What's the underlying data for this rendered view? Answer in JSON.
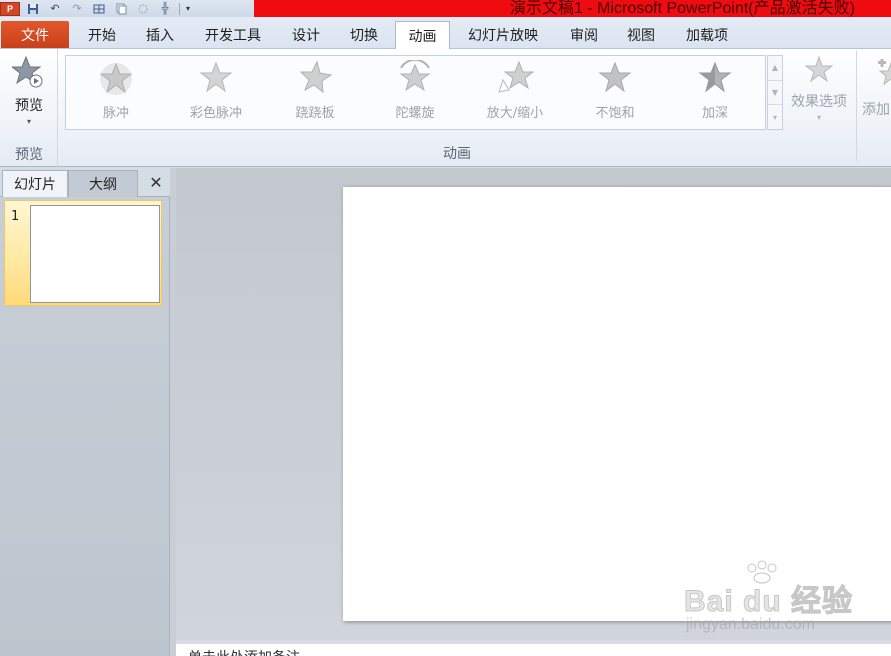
{
  "window": {
    "title": "演示文稿1 - Microsoft PowerPoint(产品激活失败)"
  },
  "quick_access": [
    {
      "icon": "save-icon"
    },
    {
      "icon": "undo-icon"
    },
    {
      "icon": "redo-icon"
    },
    {
      "icon": "table-icon"
    },
    {
      "icon": "copy-icon"
    },
    {
      "icon": "shape-icon"
    },
    {
      "icon": "format-painter-icon"
    },
    {
      "icon": "customize-dropdown-icon"
    }
  ],
  "tabs": {
    "file": "文件",
    "items": [
      "开始",
      "插入",
      "开发工具",
      "设计",
      "切换",
      "动画",
      "幻灯片放映",
      "审阅",
      "视图",
      "加载项"
    ],
    "active": "动画"
  },
  "ribbon": {
    "preview_group": {
      "button_label": "预览",
      "group_label": "预览"
    },
    "animation_group": {
      "effects": [
        "脉冲",
        "彩色脉冲",
        "跷跷板",
        "陀螺旋",
        "放大/缩小",
        "不饱和",
        "加深"
      ],
      "effect_options_label": "效果选项",
      "group_label": "动画"
    },
    "add_animation_label": "添加"
  },
  "left_panel": {
    "tab_slides": "幻灯片",
    "tab_outline": "大纲",
    "close_glyph": "✕",
    "slides": [
      {
        "number": "1"
      }
    ]
  },
  "notes": {
    "text": "单击此处添加备注"
  },
  "watermark": {
    "brand": "Bai du 经验",
    "url": "jingyan.baidu.com"
  },
  "colors": {
    "file_tab": "#d24726",
    "title_bar": "#ee0c10",
    "selection": "#ffe8a0"
  }
}
